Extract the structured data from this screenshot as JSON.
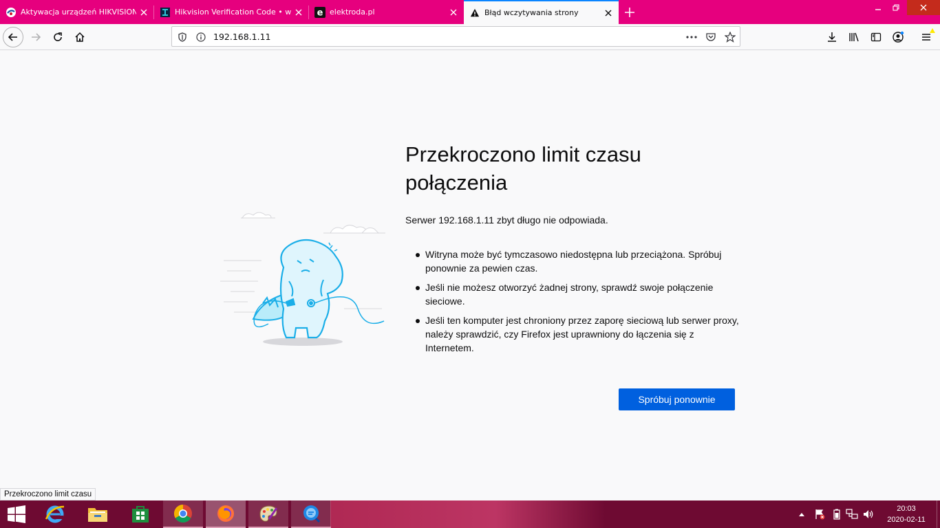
{
  "tabs": [
    {
      "title": "Aktywacja urządzeń HIKVISION - F",
      "favicon": "circle-logo-icon",
      "active": false
    },
    {
      "title": "Hikvision Verification Code • w",
      "favicon": "hikvision-icon",
      "active": false
    },
    {
      "title": "elektroda.pl",
      "favicon": "elektroda-icon",
      "active": false
    },
    {
      "title": "Błąd wczytywania strony",
      "favicon": "warning-icon",
      "active": true
    }
  ],
  "urlbar": {
    "url": "192.168.1.11"
  },
  "error": {
    "title": "Przekroczono limit czasu połączenia",
    "description": "Serwer 192.168.1.11 zbyt długo nie odpowiada.",
    "items": [
      "Witryna może być tymczasowo niedostępna lub przeciążona. Spróbuj ponownie za pewien czas.",
      "Jeśli nie możesz otworzyć żadnej strony, sprawdź swoje połączenie sieciowe.",
      "Jeśli ten komputer jest chroniony przez zaporę sieciową lub serwer proxy, należy sprawdzić, czy Firefox jest uprawniony do łączenia się z Internetem."
    ],
    "retry_label": "Spróbuj ponownie"
  },
  "statusbar": {
    "text": "Przekroczono limit czasu"
  },
  "taskbar": {
    "apps": [
      "internet-explorer-icon",
      "file-explorer-icon",
      "store-icon",
      "chrome-icon",
      "firefox-icon",
      "paint-icon",
      "magnifier-app-icon"
    ],
    "clock_time": "20:03",
    "clock_date": "2020-02-11"
  },
  "colors": {
    "tabstrip": "#e6007e",
    "accent": "#0060df",
    "taskbar": "#6e0a32"
  }
}
